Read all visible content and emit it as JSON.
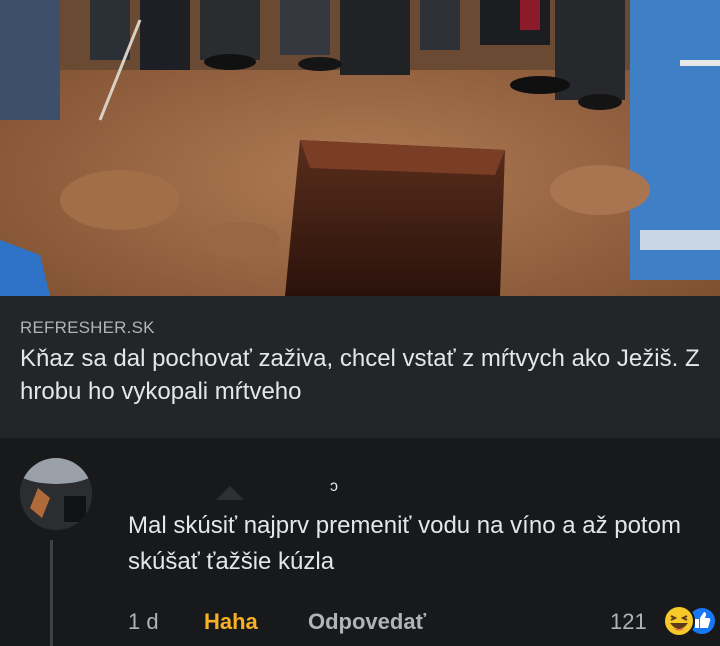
{
  "link_preview": {
    "domain": "REFRESHER.SK",
    "title": "Kňaz sa dal pochovať zaživa, chcel vstať z mŕtvych ako Ježiš. Z hrobu ho vykopali mŕtveho"
  },
  "comment": {
    "hidden_indicator": "ɔ",
    "text": "Mal skúsiť najprv premeniť vodu na víno a až potom skúšať ťažšie kúzla",
    "time": "1 d",
    "reaction_label": "Haha",
    "reply_label": "Odpovedať",
    "reaction_count": "121",
    "reaction_icons": [
      "haha-emoji-icon",
      "like-icon"
    ]
  },
  "colors": {
    "background": "#18191a",
    "card": "#242526",
    "text_primary": "#e4e6eb",
    "text_secondary": "#b0b3b8",
    "haha_accent": "#f7b125",
    "like_blue": "#1877f2"
  }
}
